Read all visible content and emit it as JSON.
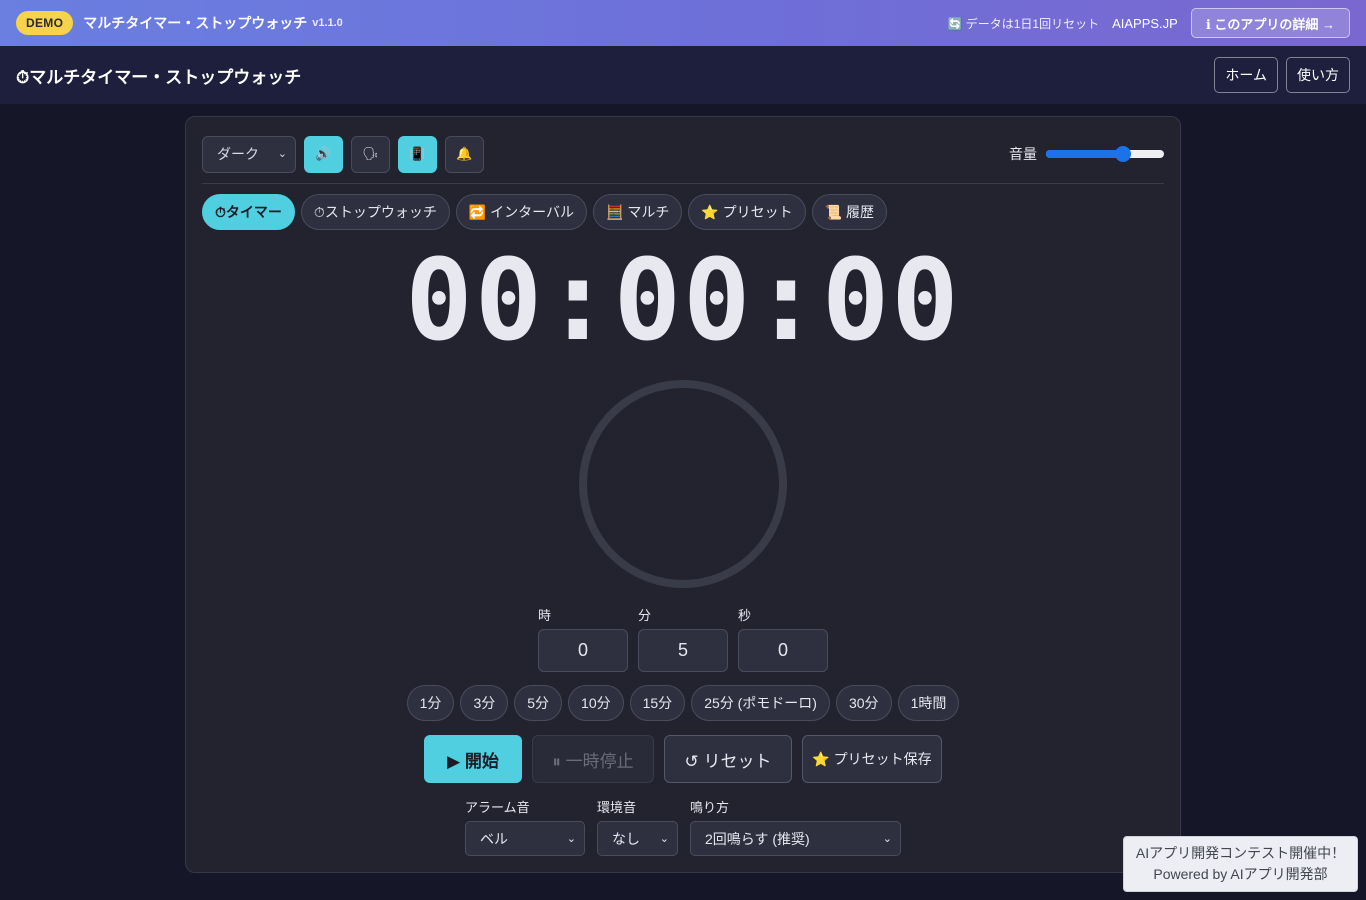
{
  "topbar": {
    "badge": "DEMO",
    "app_name": "マルチタイマー・ストップウォッチ",
    "version": "v1.1.0",
    "reset_note": "🔄 データは1日1回リセット",
    "brand": "AIAPPS.JP",
    "details_button": "ℹ このアプリの詳細 →"
  },
  "header": {
    "title": "⏱マルチタイマー・ストップウォッチ",
    "nav": [
      "ホーム",
      "使い方"
    ]
  },
  "controls": {
    "theme_value": "ダーク",
    "sound_icon": "🔊",
    "voice_icon": "🗣",
    "vibrate_icon": "📳",
    "notify_icon": "🔔",
    "volume_label": "音量",
    "volume_level": 0.65,
    "accent_color": "#4fcfe0"
  },
  "tabs": [
    {
      "label": "⏱タイマー",
      "active": true
    },
    {
      "label": "⏱ストップウォッチ",
      "active": false
    },
    {
      "label": "🔁 インターバル",
      "active": false
    },
    {
      "label": "🧮 マルチ",
      "active": false
    },
    {
      "label": "⭐ プリセット",
      "active": false
    },
    {
      "label": "📜 履歴",
      "active": false
    }
  ],
  "timer": {
    "display": "00:00:00",
    "progress": 0
  },
  "inputs": {
    "hours_label": "時",
    "hours_value": "0",
    "minutes_label": "分",
    "minutes_value": "5",
    "seconds_label": "秒",
    "seconds_value": "0"
  },
  "presets": [
    "1分",
    "3分",
    "5分",
    "10分",
    "15分",
    "25分 (ポモドーロ)",
    "30分",
    "1時間"
  ],
  "actions": {
    "start": "▶ 開始",
    "pause": "⏸ 一時停止",
    "reset": "↺ リセット",
    "save_preset": "⭐ プリセット保存"
  },
  "sound": {
    "alarm_label": "アラーム音",
    "alarm_value": "ベル",
    "ambient_label": "環境音",
    "ambient_value": "なし",
    "ring_label": "鳴り方",
    "ring_value": "2回鳴らす (推奨)"
  },
  "promo": {
    "line1": "AIアプリ開発コンテスト開催中！",
    "line2": "Powered by AIアプリ開発部"
  }
}
